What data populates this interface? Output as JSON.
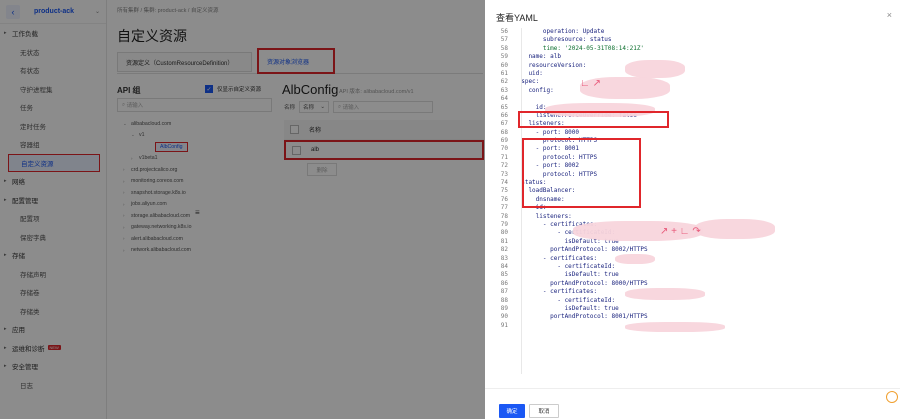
{
  "sidebar": {
    "cluster": "product-ack",
    "items": [
      {
        "label": "工作负载",
        "kind": "group"
      },
      {
        "label": "无状态",
        "kind": "sub"
      },
      {
        "label": "有状态",
        "kind": "sub"
      },
      {
        "label": "守护进程集",
        "kind": "sub"
      },
      {
        "label": "任务",
        "kind": "sub"
      },
      {
        "label": "定时任务",
        "kind": "sub"
      },
      {
        "label": "容器组",
        "kind": "sub"
      },
      {
        "label": "自定义资源",
        "kind": "active"
      },
      {
        "label": "网络",
        "kind": "group"
      },
      {
        "label": "配置管理",
        "kind": "group"
      },
      {
        "label": "配置项",
        "kind": "sub"
      },
      {
        "label": "保密字典",
        "kind": "sub"
      },
      {
        "label": "存储",
        "kind": "group"
      },
      {
        "label": "存储声明",
        "kind": "sub"
      },
      {
        "label": "存储卷",
        "kind": "sub"
      },
      {
        "label": "存储类",
        "kind": "sub"
      },
      {
        "label": "应用",
        "kind": "group"
      },
      {
        "label": "运维和诊断",
        "kind": "group",
        "badge": "NEW"
      },
      {
        "label": "安全管理",
        "kind": "group"
      },
      {
        "label": "日志",
        "kind": "sub"
      }
    ]
  },
  "main": {
    "breadcrumb": "所有集群 / 集群: product-ack / 自定义资源",
    "title": "自定义资源",
    "tabs": [
      "资源定义（CustomResourceDefinition）",
      "资源对象浏览器"
    ],
    "api_group_label": "API 组",
    "checkbox_label": "仅显示自定义资源",
    "search_placeholder": "请输入",
    "tree": [
      {
        "label": "alibabacloud.com",
        "level": 1,
        "tri": "⌄"
      },
      {
        "label": "v1",
        "level": 2,
        "tri": "⌄"
      },
      {
        "label": "AlbConfig",
        "level": 3,
        "tri": "",
        "selected": true
      },
      {
        "label": "v1beta1",
        "level": 2,
        "tri": "›"
      },
      {
        "label": "crd.projectcalico.org",
        "level": 1,
        "tri": "›"
      },
      {
        "label": "monitoring.coreos.com",
        "level": 1,
        "tri": "›"
      },
      {
        "label": "snapshot.storage.k8s.io",
        "level": 1,
        "tri": "›"
      },
      {
        "label": "jobs.aliyun.com",
        "level": 1,
        "tri": "›"
      },
      {
        "label": "storage.alibabacloud.com",
        "level": 1,
        "tri": "›"
      },
      {
        "label": "gateway.networking.k8s.io",
        "level": 1,
        "tri": "›"
      },
      {
        "label": "alert.alibabacloud.com",
        "level": 1,
        "tri": "›"
      },
      {
        "label": "network.alibabacloud.com",
        "level": 1,
        "tri": "›"
      }
    ],
    "resource_title": "AlbConfig",
    "resource_version": "API 版本: alibabacloud.com/v1",
    "filter_label": "名称",
    "filter_select": "名称",
    "filter_placeholder": "请输入",
    "table_header": "名称",
    "table_rows": [
      "alb"
    ],
    "delete_label": "删除"
  },
  "drawer": {
    "title": "查看YAML",
    "close_icon": "×",
    "ok_label": "确定",
    "cancel_label": "取消",
    "lines": [
      {
        "n": "56",
        "t": "        operation: Update"
      },
      {
        "n": "57",
        "t": "        subresource: status"
      },
      {
        "n": "58",
        "t": "        time: '2024-05-31T08:14:21Z'",
        "str": true
      },
      {
        "n": "59",
        "t": "    name: alb"
      },
      {
        "n": "60",
        "t": "    resourceVersion: "
      },
      {
        "n": "61",
        "t": "    uid: "
      },
      {
        "n": "62",
        "t": "  spec:"
      },
      {
        "n": "63",
        "t": "    config:"
      },
      {
        "n": "64",
        "t": "      "
      },
      {
        "n": "65",
        "t": "      id: "
      },
      {
        "n": "66",
        "t": "      listenerForceOverride: false"
      },
      {
        "n": "67",
        "t": "    listeners:"
      },
      {
        "n": "68",
        "t": "      - port: 8000"
      },
      {
        "n": "69",
        "t": "        protocol: HTTPS"
      },
      {
        "n": "70",
        "t": "      - port: 8001"
      },
      {
        "n": "71",
        "t": "        protocol: HTTPS"
      },
      {
        "n": "72",
        "t": "      - port: 8002"
      },
      {
        "n": "73",
        "t": "        protocol: HTTPS"
      },
      {
        "n": "74",
        "t": "  status:"
      },
      {
        "n": "75",
        "t": "    loadBalancer:"
      },
      {
        "n": "76",
        "t": "      dnsname: "
      },
      {
        "n": "77",
        "t": "      id: "
      },
      {
        "n": "78",
        "t": "      listeners:"
      },
      {
        "n": "79",
        "t": "        - certificates:"
      },
      {
        "n": "80",
        "t": "            - certificateId: "
      },
      {
        "n": "81",
        "t": "              isDefault: true"
      },
      {
        "n": "82",
        "t": "          portAndProtocol: 8002/HTTPS"
      },
      {
        "n": "83",
        "t": "        - certificates:"
      },
      {
        "n": "84",
        "t": "            - certificateId: "
      },
      {
        "n": "85",
        "t": "              isDefault: true"
      },
      {
        "n": "86",
        "t": "          portAndProtocol: 8000/HTTPS"
      },
      {
        "n": "87",
        "t": "        - certificates:"
      },
      {
        "n": "88",
        "t": "            - certificateId: "
      },
      {
        "n": "89",
        "t": "              isDefault: true"
      },
      {
        "n": "90",
        "t": "          portAndProtocol: 8001/HTTPS"
      },
      {
        "n": "91",
        "t": ""
      }
    ]
  },
  "colors": {
    "accent": "#1b58f4",
    "highlight": "#e0262b",
    "code": "#1a237e",
    "string": "#0a6e2c"
  }
}
